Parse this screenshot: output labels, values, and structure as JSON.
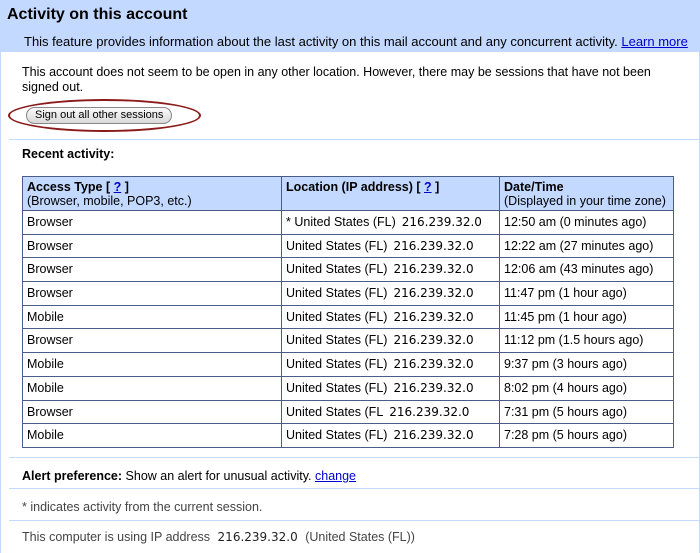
{
  "header": {
    "title": "Activity on this account",
    "subtitle": "This feature provides information about the last activity on this mail account and any concurrent activity.",
    "learn_more": "Learn more"
  },
  "notice": "This account does not seem to be open in any other location. However, there may be sessions that have not been signed out.",
  "signout_button": "Sign out all other sessions",
  "recent_activity_label": "Recent activity:",
  "table": {
    "headers": {
      "access_type": "Access Type",
      "access_type_sub": "(Browser, mobile, POP3, etc.)",
      "location": "Location (IP address)",
      "date_time": "Date/Time",
      "date_time_sub": "(Displayed in your time zone)",
      "help": "?"
    },
    "rows": [
      {
        "type": "Browser",
        "location": "* United States (FL)",
        "ip": "216.239.32.0",
        "time": "12:50 am (0 minutes ago)"
      },
      {
        "type": "Browser",
        "location": "United States (FL)",
        "ip": "216.239.32.0",
        "time": "12:22 am (27 minutes ago)"
      },
      {
        "type": "Browser",
        "location": "United States (FL)",
        "ip": "216.239.32.0",
        "time": "12:06 am (43 minutes ago)"
      },
      {
        "type": "Browser",
        "location": "United States (FL)",
        "ip": "216.239.32.0",
        "time": "11:47 pm (1 hour ago)"
      },
      {
        "type": "Mobile",
        "location": "United States (FL)",
        "ip": "216.239.32.0",
        "time": "11:45 pm (1 hour ago)"
      },
      {
        "type": "Browser",
        "location": "United States (FL)",
        "ip": "216.239.32.0",
        "time": "11:12 pm (1.5 hours ago)"
      },
      {
        "type": "Mobile",
        "location": "United States (FL)",
        "ip": "216.239.32.0",
        "time": "9:37 pm (3 hours ago)"
      },
      {
        "type": "Mobile",
        "location": "United States (FL)",
        "ip": "216.239.32.0",
        "time": "8:02 pm (4 hours ago)"
      },
      {
        "type": "Browser",
        "location": "United States (FL",
        "ip": "216.239.32.0",
        "time": "7:31 pm (5 hours ago)"
      },
      {
        "type": "Mobile",
        "location": "United States (FL)",
        "ip": "216.239.32.0",
        "time": "7:28 pm (5 hours ago)"
      }
    ]
  },
  "alert": {
    "label": "Alert preference:",
    "text": "Show an alert for unusual activity.",
    "change": "change"
  },
  "footnote": "* indicates activity from the current session.",
  "ip_info": {
    "prefix": "This computer is using IP address",
    "ip": "216.239.32.0",
    "location": "(United States (FL))"
  },
  "colors": {
    "header_bg": "#c3d9ff",
    "link": "#0000cc",
    "highlight_ring": "#8b1a1a",
    "table_border": "#4a5c8a"
  }
}
